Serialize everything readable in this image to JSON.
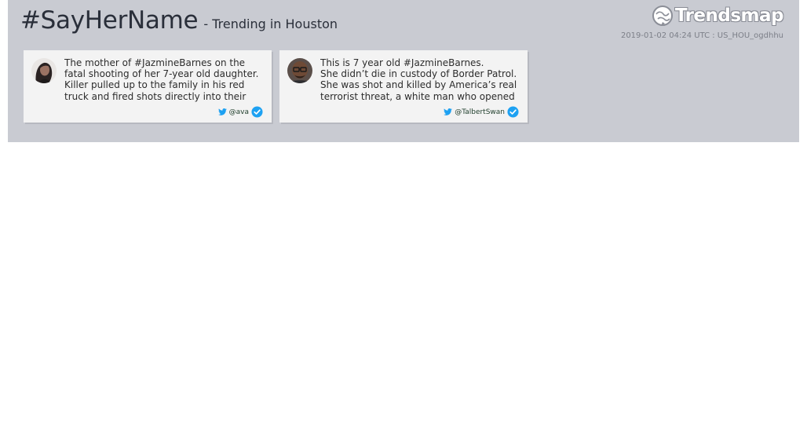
{
  "header": {
    "hashtag": "#SayHerName",
    "subtitle": "- Trending in Houston",
    "brand": "Trendsmap",
    "meta": "2019-01-02 04:24 UTC : US_HOU_ogdhhu"
  },
  "tweets": [
    {
      "lines": [
        "The mother of #JazmineBarnes on the",
        "fatal shooting of her 7-year old daughter.",
        "Killer pulled up to the family in his red",
        "truck and fired shots directly into their"
      ],
      "handle": "@ava",
      "icons": [
        "twitter-bird-icon",
        "verified-badge-icon"
      ]
    },
    {
      "lines": [
        "This is 7 year old #JazmineBarnes.",
        "She didn’t die in custody of Border Patrol.",
        "She was shot and killed by America’s real",
        "terrorist threat, a white man who opened"
      ],
      "handle": "@TalbertSwan",
      "icons": [
        "twitter-bird-icon",
        "verified-badge-icon"
      ]
    }
  ],
  "colors": {
    "panel_bg": "#c9cbd2",
    "card_bg": "#f3f3f3",
    "twitter_blue": "#1da1f2",
    "headline_text": "#2a2f3a"
  }
}
